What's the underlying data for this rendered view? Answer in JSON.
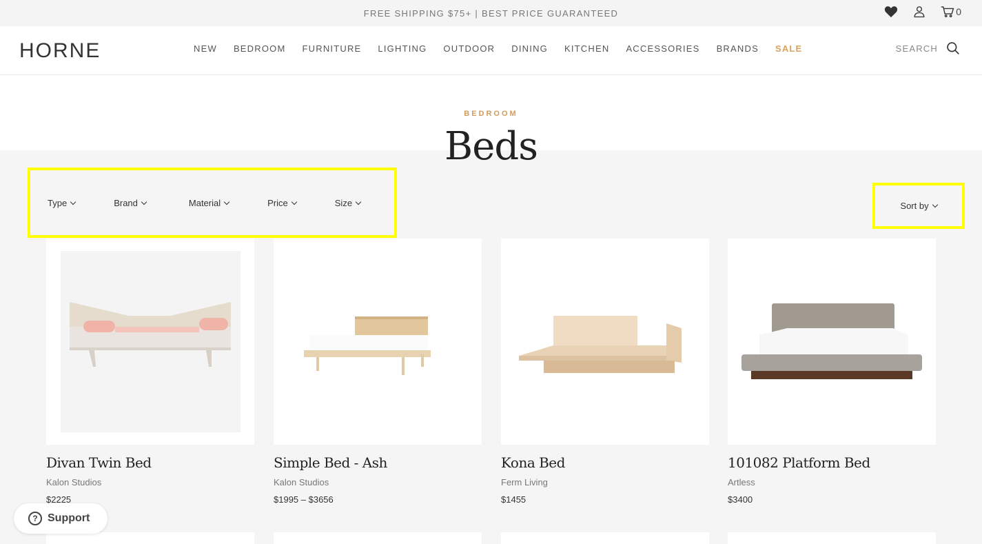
{
  "announcement": "FREE SHIPPING $75+ | BEST PRICE GUARANTEED",
  "top_icons": {
    "wishlist": "heart-icon",
    "account": "user-icon",
    "cart": "cart-icon",
    "cart_count": "0"
  },
  "header": {
    "logo": "HORNE",
    "nav": [
      "NEW",
      "BEDROOM",
      "FURNITURE",
      "LIGHTING",
      "OUTDOOR",
      "DINING",
      "KITCHEN",
      "ACCESSORIES",
      "BRANDS",
      "SALE"
    ],
    "search_label": "SEARCH"
  },
  "page": {
    "eyebrow": "BEDROOM",
    "title": "Beds"
  },
  "filters": [
    "Type",
    "Brand",
    "Material",
    "Price",
    "Size"
  ],
  "sort_label": "Sort by",
  "products": [
    {
      "name": "Divan Twin Bed",
      "brand": "Kalon Studios",
      "price": "$2225"
    },
    {
      "name": "Simple Bed - Ash",
      "brand": "Kalon Studios",
      "price": "$1995 – $3656"
    },
    {
      "name": "Kona Bed",
      "brand": "Ferm Living",
      "price": "$1455"
    },
    {
      "name": "101082 Platform Bed",
      "brand": "Artless",
      "price": "$3400"
    }
  ],
  "support": {
    "label": "Support",
    "glyph": "?"
  },
  "colors": {
    "accent": "#d29b5c",
    "highlight": "#ffff00",
    "background": "#f5f5f5"
  }
}
